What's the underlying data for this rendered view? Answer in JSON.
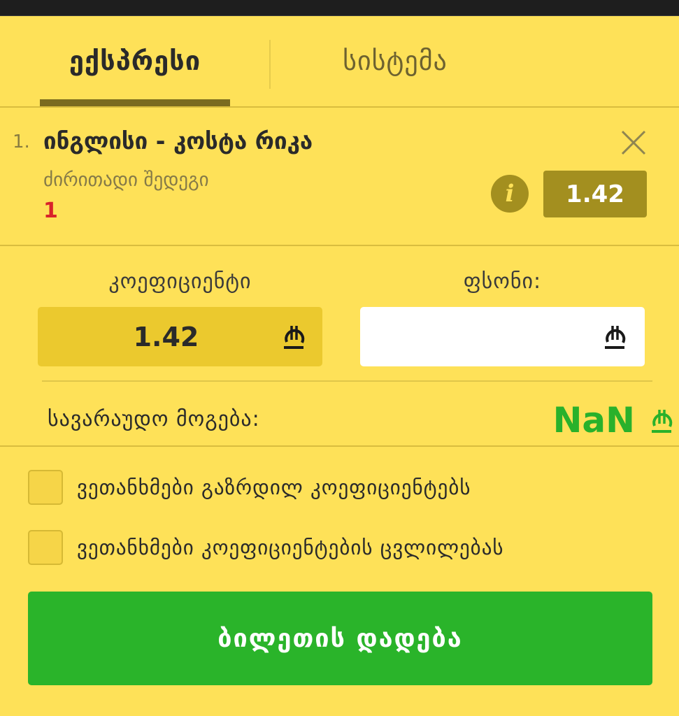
{
  "tabs": {
    "express": "ექსპრესი",
    "system": "სისტემა",
    "active": "express"
  },
  "selection": {
    "number": "1.",
    "match": "ინგლისი - კოსტა რიკა",
    "market": "ძირითადი შედეგი",
    "outcome": "1",
    "odds": "1.42"
  },
  "coefficient": {
    "label": "კოეფიციენტი",
    "value": "1.42"
  },
  "stake": {
    "label": "ფსონი:",
    "value": "",
    "placeholder": ""
  },
  "possible_win": {
    "label": "სავარაუდო მოგება:",
    "value": "NaN"
  },
  "options": [
    {
      "label": "ვეთანხმები გაზრდილ კოეფიციენტებს",
      "checked": false
    },
    {
      "label": "ვეთანხმები კოეფიციენტების ცვლილებას",
      "checked": false
    }
  ],
  "place_bet_label": "ბილეთის დადება",
  "colors": {
    "background": "#fee158",
    "accent_dark": "#a38f1f",
    "win_green": "#29b12b",
    "button_green": "#2ab42a",
    "outcome_red": "#d8232a"
  },
  "icons": {
    "close": "close-icon",
    "info": "info-icon",
    "currency": "lari-icon"
  }
}
